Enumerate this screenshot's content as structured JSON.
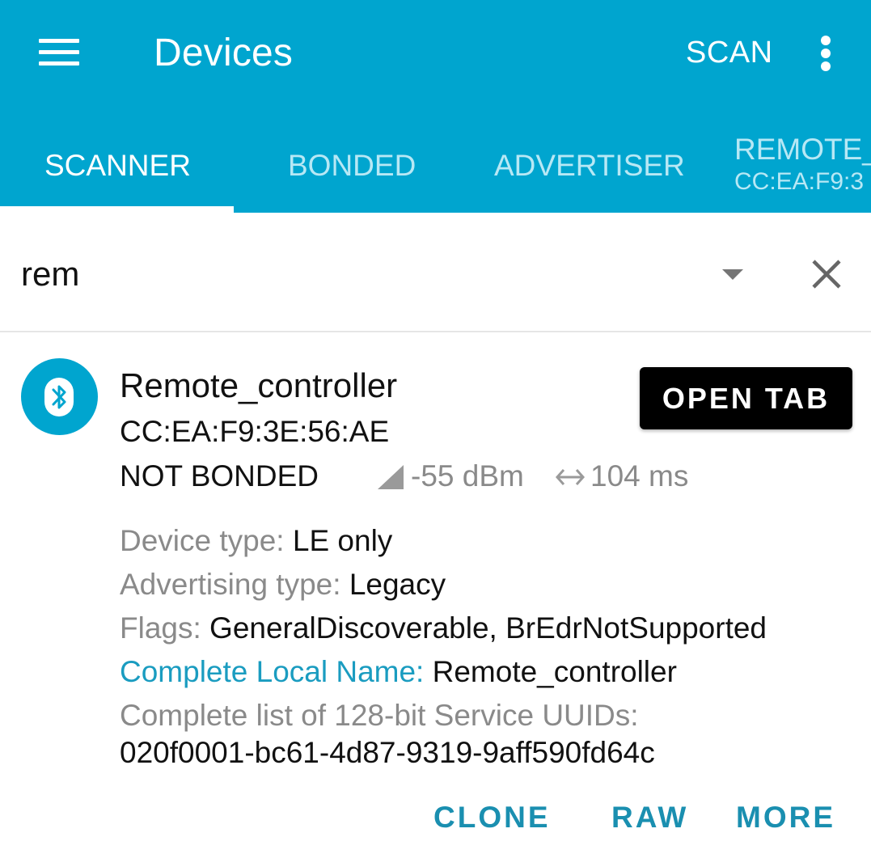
{
  "appbar": {
    "title": "Devices",
    "scan_label": "SCAN",
    "background": "#00a5cf"
  },
  "tabs": [
    {
      "label": "SCANNER",
      "active": true
    },
    {
      "label": "BONDED",
      "active": false
    },
    {
      "label": "ADVERTISER",
      "active": false
    },
    {
      "label": "REMOTE_",
      "sublabel": "CC:EA:F9:3",
      "active": false
    }
  ],
  "filter": {
    "value": "rem"
  },
  "device": {
    "name": "Remote_controller",
    "address": "CC:EA:F9:3E:56:AE",
    "bond_state": "NOT BONDED",
    "rssi": "-55 dBm",
    "interval": "104 ms",
    "open_tab_label": "OPEN TAB",
    "details": [
      {
        "key": "Device type: ",
        "value": "LE only"
      },
      {
        "key": "Advertising type: ",
        "value": "Legacy"
      },
      {
        "key": "Flags: ",
        "value": "GeneralDiscoverable, BrEdrNotSupported"
      },
      {
        "key": "Complete Local Name: ",
        "value": "Remote_controller"
      }
    ],
    "uuid_label": "Complete list of 128-bit Service UUIDs:",
    "uuid_value": "020f0001-bc61-4d87-9319-9aff590fd64c",
    "actions": {
      "clone": "CLONE",
      "raw": "RAW",
      "more": "MORE"
    }
  },
  "icons": {
    "menu": "menu-icon",
    "overflow": "more-vert-icon",
    "dropdown": "dropdown-arrow-icon",
    "clear": "close-icon",
    "bluetooth": "bluetooth-icon",
    "signal": "signal-strength-icon",
    "interval": "interval-arrows-icon"
  }
}
